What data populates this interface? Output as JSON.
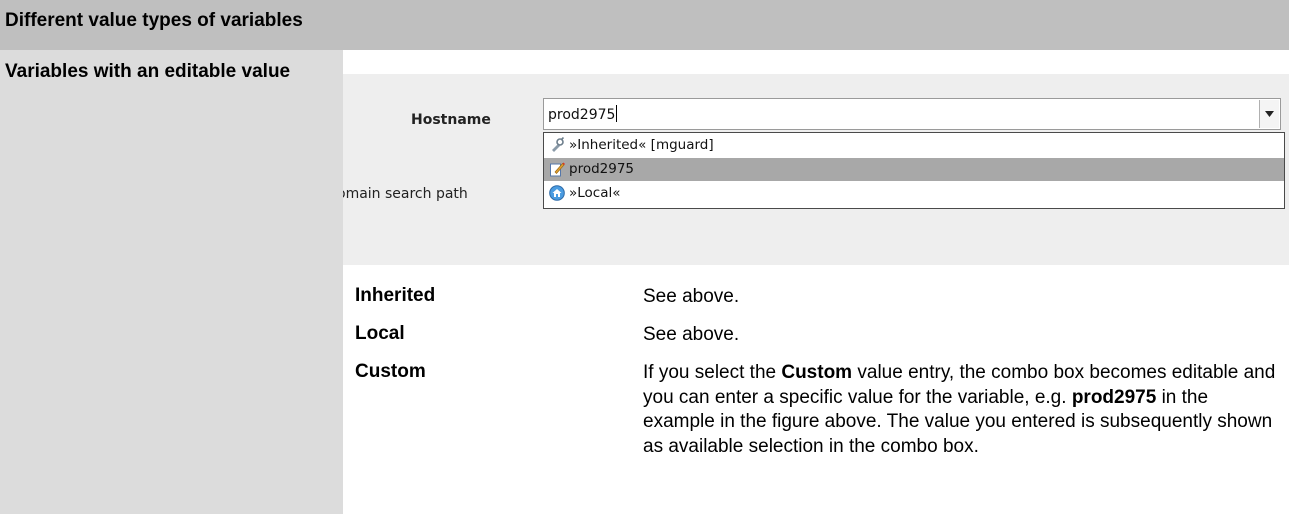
{
  "header": {
    "title": "Different value types of variables"
  },
  "left": {
    "label": "Variables with an editable value"
  },
  "screenshot": {
    "hostname_label": "Hostname",
    "domain_label": "omain search path",
    "combo": {
      "value": "prod2975"
    },
    "options": [
      {
        "icon": "inherited-icon",
        "label": "»Inherited« [mguard]"
      },
      {
        "icon": "edit-icon",
        "label": "prod2975",
        "selected": true
      },
      {
        "icon": "local-home-icon",
        "label": "»Local«"
      }
    ]
  },
  "rows": [
    {
      "term": "Inherited",
      "desc": "See above."
    },
    {
      "term": "Local",
      "desc": "See above."
    },
    {
      "term": "Custom",
      "desc_parts": [
        "If you select the ",
        "Custom",
        " value entry, the combo box becomes editable and you can enter a specific value for the variable, e.g. ",
        "prod2975",
        " in the example in the figure above. The value you entered is subsequently shown as available selection in the combo box."
      ]
    }
  ]
}
